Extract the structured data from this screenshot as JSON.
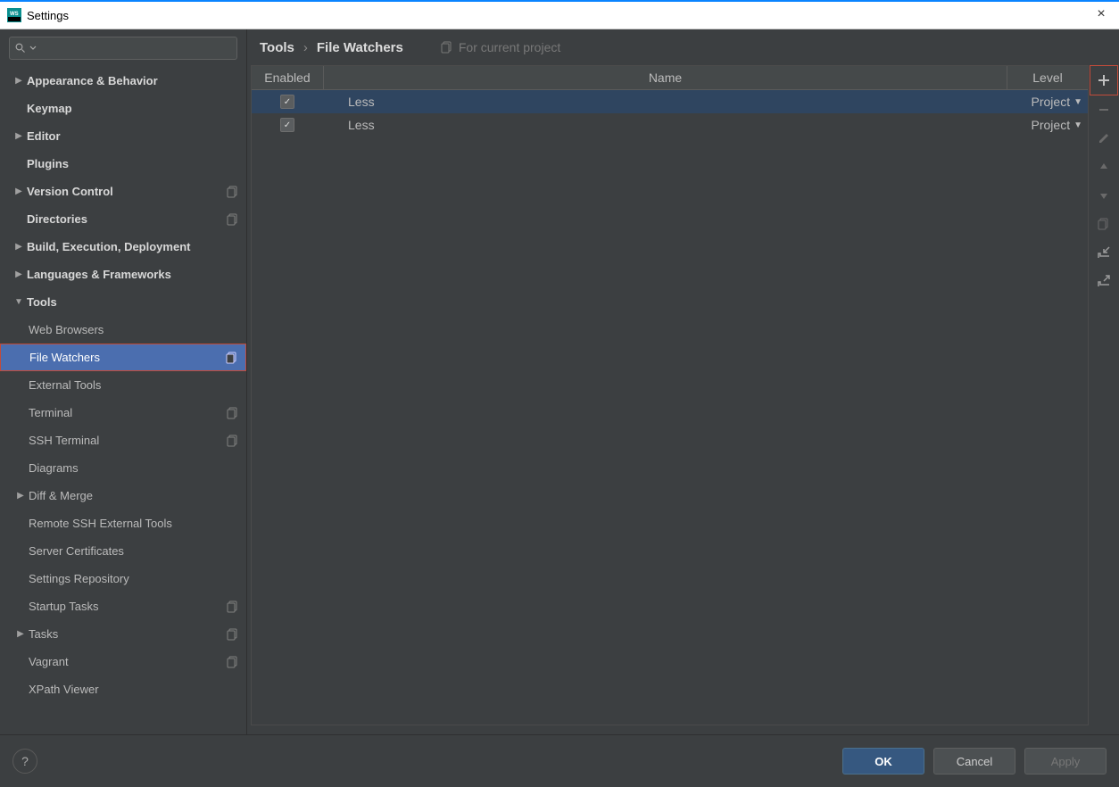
{
  "window": {
    "title": "Settings",
    "close_label": "×"
  },
  "search": {
    "placeholder": ""
  },
  "sidebar": {
    "items": [
      {
        "label": "Appearance & Behavior",
        "depth": 0,
        "bold": true,
        "arrow": "right",
        "project": false,
        "selected": false
      },
      {
        "label": "Keymap",
        "depth": 0,
        "bold": true,
        "arrow": "",
        "project": false,
        "selected": false,
        "indentNoArrow": true
      },
      {
        "label": "Editor",
        "depth": 0,
        "bold": true,
        "arrow": "right",
        "project": false,
        "selected": false
      },
      {
        "label": "Plugins",
        "depth": 0,
        "bold": true,
        "arrow": "",
        "project": false,
        "selected": false,
        "indentNoArrow": true
      },
      {
        "label": "Version Control",
        "depth": 0,
        "bold": true,
        "arrow": "right",
        "project": true,
        "selected": false
      },
      {
        "label": "Directories",
        "depth": 0,
        "bold": true,
        "arrow": "",
        "project": true,
        "selected": false,
        "indentNoArrow": true
      },
      {
        "label": "Build, Execution, Deployment",
        "depth": 0,
        "bold": true,
        "arrow": "right",
        "project": false,
        "selected": false
      },
      {
        "label": "Languages & Frameworks",
        "depth": 0,
        "bold": true,
        "arrow": "right",
        "project": false,
        "selected": false
      },
      {
        "label": "Tools",
        "depth": 0,
        "bold": true,
        "arrow": "down",
        "project": false,
        "selected": false
      },
      {
        "label": "Web Browsers",
        "depth": 1,
        "bold": false,
        "arrow": "",
        "project": false,
        "selected": false
      },
      {
        "label": "File Watchers",
        "depth": 1,
        "bold": false,
        "arrow": "",
        "project": true,
        "selected": true
      },
      {
        "label": "External Tools",
        "depth": 1,
        "bold": false,
        "arrow": "",
        "project": false,
        "selected": false
      },
      {
        "label": "Terminal",
        "depth": 1,
        "bold": false,
        "arrow": "",
        "project": true,
        "selected": false
      },
      {
        "label": "SSH Terminal",
        "depth": 1,
        "bold": false,
        "arrow": "",
        "project": true,
        "selected": false
      },
      {
        "label": "Diagrams",
        "depth": 1,
        "bold": false,
        "arrow": "",
        "project": false,
        "selected": false
      },
      {
        "label": "Diff & Merge",
        "depth": 1,
        "bold": false,
        "arrow": "right",
        "project": false,
        "selected": false
      },
      {
        "label": "Remote SSH External Tools",
        "depth": 1,
        "bold": false,
        "arrow": "",
        "project": false,
        "selected": false
      },
      {
        "label": "Server Certificates",
        "depth": 1,
        "bold": false,
        "arrow": "",
        "project": false,
        "selected": false
      },
      {
        "label": "Settings Repository",
        "depth": 1,
        "bold": false,
        "arrow": "",
        "project": false,
        "selected": false
      },
      {
        "label": "Startup Tasks",
        "depth": 1,
        "bold": false,
        "arrow": "",
        "project": true,
        "selected": false
      },
      {
        "label": "Tasks",
        "depth": 1,
        "bold": false,
        "arrow": "right",
        "project": true,
        "selected": false
      },
      {
        "label": "Vagrant",
        "depth": 1,
        "bold": false,
        "arrow": "",
        "project": true,
        "selected": false
      },
      {
        "label": "XPath Viewer",
        "depth": 1,
        "bold": false,
        "arrow": "",
        "project": false,
        "selected": false
      }
    ]
  },
  "breadcrumb": {
    "crumb1": "Tools",
    "crumb2": "File Watchers",
    "scope": "For current project"
  },
  "table": {
    "headers": {
      "enabled": "Enabled",
      "name": "Name",
      "level": "Level"
    },
    "rows": [
      {
        "enabled": true,
        "name": "Less",
        "level": "Project",
        "selected": true
      },
      {
        "enabled": true,
        "name": "Less",
        "level": "Project",
        "selected": false
      }
    ]
  },
  "toolbar": {
    "add": "+",
    "remove": "−"
  },
  "footer": {
    "help": "?",
    "ok": "OK",
    "cancel": "Cancel",
    "apply": "Apply"
  }
}
